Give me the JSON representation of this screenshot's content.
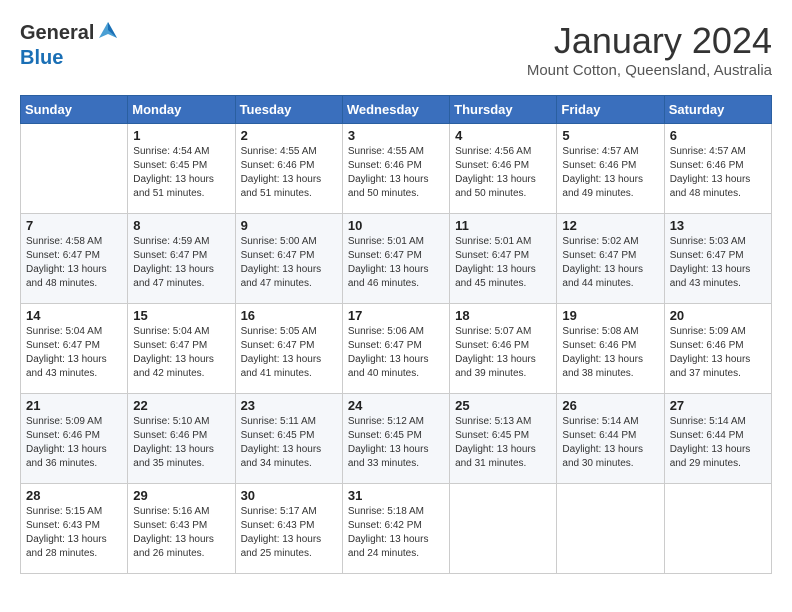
{
  "logo": {
    "general": "General",
    "blue": "Blue"
  },
  "header": {
    "month_year": "January 2024",
    "location": "Mount Cotton, Queensland, Australia"
  },
  "weekdays": [
    "Sunday",
    "Monday",
    "Tuesday",
    "Wednesday",
    "Thursday",
    "Friday",
    "Saturday"
  ],
  "weeks": [
    [
      {
        "day": "",
        "sunrise": "",
        "sunset": "",
        "daylight": ""
      },
      {
        "day": "1",
        "sunrise": "Sunrise: 4:54 AM",
        "sunset": "Sunset: 6:45 PM",
        "daylight": "Daylight: 13 hours and 51 minutes."
      },
      {
        "day": "2",
        "sunrise": "Sunrise: 4:55 AM",
        "sunset": "Sunset: 6:46 PM",
        "daylight": "Daylight: 13 hours and 51 minutes."
      },
      {
        "day": "3",
        "sunrise": "Sunrise: 4:55 AM",
        "sunset": "Sunset: 6:46 PM",
        "daylight": "Daylight: 13 hours and 50 minutes."
      },
      {
        "day": "4",
        "sunrise": "Sunrise: 4:56 AM",
        "sunset": "Sunset: 6:46 PM",
        "daylight": "Daylight: 13 hours and 50 minutes."
      },
      {
        "day": "5",
        "sunrise": "Sunrise: 4:57 AM",
        "sunset": "Sunset: 6:46 PM",
        "daylight": "Daylight: 13 hours and 49 minutes."
      },
      {
        "day": "6",
        "sunrise": "Sunrise: 4:57 AM",
        "sunset": "Sunset: 6:46 PM",
        "daylight": "Daylight: 13 hours and 48 minutes."
      }
    ],
    [
      {
        "day": "7",
        "sunrise": "Sunrise: 4:58 AM",
        "sunset": "Sunset: 6:47 PM",
        "daylight": "Daylight: 13 hours and 48 minutes."
      },
      {
        "day": "8",
        "sunrise": "Sunrise: 4:59 AM",
        "sunset": "Sunset: 6:47 PM",
        "daylight": "Daylight: 13 hours and 47 minutes."
      },
      {
        "day": "9",
        "sunrise": "Sunrise: 5:00 AM",
        "sunset": "Sunset: 6:47 PM",
        "daylight": "Daylight: 13 hours and 47 minutes."
      },
      {
        "day": "10",
        "sunrise": "Sunrise: 5:01 AM",
        "sunset": "Sunset: 6:47 PM",
        "daylight": "Daylight: 13 hours and 46 minutes."
      },
      {
        "day": "11",
        "sunrise": "Sunrise: 5:01 AM",
        "sunset": "Sunset: 6:47 PM",
        "daylight": "Daylight: 13 hours and 45 minutes."
      },
      {
        "day": "12",
        "sunrise": "Sunrise: 5:02 AM",
        "sunset": "Sunset: 6:47 PM",
        "daylight": "Daylight: 13 hours and 44 minutes."
      },
      {
        "day": "13",
        "sunrise": "Sunrise: 5:03 AM",
        "sunset": "Sunset: 6:47 PM",
        "daylight": "Daylight: 13 hours and 43 minutes."
      }
    ],
    [
      {
        "day": "14",
        "sunrise": "Sunrise: 5:04 AM",
        "sunset": "Sunset: 6:47 PM",
        "daylight": "Daylight: 13 hours and 43 minutes."
      },
      {
        "day": "15",
        "sunrise": "Sunrise: 5:04 AM",
        "sunset": "Sunset: 6:47 PM",
        "daylight": "Daylight: 13 hours and 42 minutes."
      },
      {
        "day": "16",
        "sunrise": "Sunrise: 5:05 AM",
        "sunset": "Sunset: 6:47 PM",
        "daylight": "Daylight: 13 hours and 41 minutes."
      },
      {
        "day": "17",
        "sunrise": "Sunrise: 5:06 AM",
        "sunset": "Sunset: 6:47 PM",
        "daylight": "Daylight: 13 hours and 40 minutes."
      },
      {
        "day": "18",
        "sunrise": "Sunrise: 5:07 AM",
        "sunset": "Sunset: 6:46 PM",
        "daylight": "Daylight: 13 hours and 39 minutes."
      },
      {
        "day": "19",
        "sunrise": "Sunrise: 5:08 AM",
        "sunset": "Sunset: 6:46 PM",
        "daylight": "Daylight: 13 hours and 38 minutes."
      },
      {
        "day": "20",
        "sunrise": "Sunrise: 5:09 AM",
        "sunset": "Sunset: 6:46 PM",
        "daylight": "Daylight: 13 hours and 37 minutes."
      }
    ],
    [
      {
        "day": "21",
        "sunrise": "Sunrise: 5:09 AM",
        "sunset": "Sunset: 6:46 PM",
        "daylight": "Daylight: 13 hours and 36 minutes."
      },
      {
        "day": "22",
        "sunrise": "Sunrise: 5:10 AM",
        "sunset": "Sunset: 6:46 PM",
        "daylight": "Daylight: 13 hours and 35 minutes."
      },
      {
        "day": "23",
        "sunrise": "Sunrise: 5:11 AM",
        "sunset": "Sunset: 6:45 PM",
        "daylight": "Daylight: 13 hours and 34 minutes."
      },
      {
        "day": "24",
        "sunrise": "Sunrise: 5:12 AM",
        "sunset": "Sunset: 6:45 PM",
        "daylight": "Daylight: 13 hours and 33 minutes."
      },
      {
        "day": "25",
        "sunrise": "Sunrise: 5:13 AM",
        "sunset": "Sunset: 6:45 PM",
        "daylight": "Daylight: 13 hours and 31 minutes."
      },
      {
        "day": "26",
        "sunrise": "Sunrise: 5:14 AM",
        "sunset": "Sunset: 6:44 PM",
        "daylight": "Daylight: 13 hours and 30 minutes."
      },
      {
        "day": "27",
        "sunrise": "Sunrise: 5:14 AM",
        "sunset": "Sunset: 6:44 PM",
        "daylight": "Daylight: 13 hours and 29 minutes."
      }
    ],
    [
      {
        "day": "28",
        "sunrise": "Sunrise: 5:15 AM",
        "sunset": "Sunset: 6:43 PM",
        "daylight": "Daylight: 13 hours and 28 minutes."
      },
      {
        "day": "29",
        "sunrise": "Sunrise: 5:16 AM",
        "sunset": "Sunset: 6:43 PM",
        "daylight": "Daylight: 13 hours and 26 minutes."
      },
      {
        "day": "30",
        "sunrise": "Sunrise: 5:17 AM",
        "sunset": "Sunset: 6:43 PM",
        "daylight": "Daylight: 13 hours and 25 minutes."
      },
      {
        "day": "31",
        "sunrise": "Sunrise: 5:18 AM",
        "sunset": "Sunset: 6:42 PM",
        "daylight": "Daylight: 13 hours and 24 minutes."
      },
      {
        "day": "",
        "sunrise": "",
        "sunset": "",
        "daylight": ""
      },
      {
        "day": "",
        "sunrise": "",
        "sunset": "",
        "daylight": ""
      },
      {
        "day": "",
        "sunrise": "",
        "sunset": "",
        "daylight": ""
      }
    ]
  ]
}
